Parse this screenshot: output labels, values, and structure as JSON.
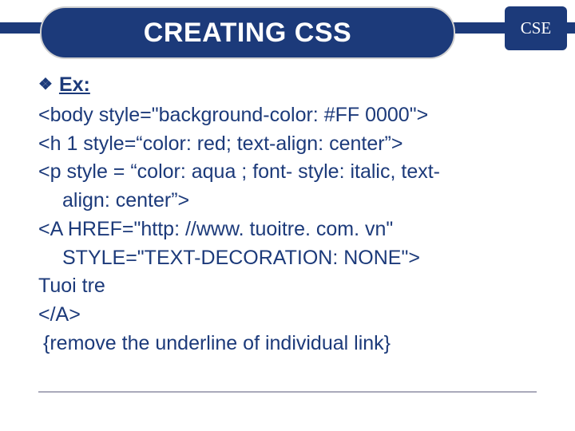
{
  "badge": "CSE",
  "title": "CREATING CSS",
  "bullet_glyph": "❖",
  "ex_label": "Ex:",
  "lines": {
    "l1": "<body style=\"background-color: #FF 0000\">",
    "l2": "<h 1 style=“color: red; text-align: center”>",
    "l3a": "<p style = “color: aqua ; font- style: italic, text-",
    "l3b": "align: center”>",
    "l4a": "<A HREF=\"http: //www. tuoitre. com. vn\"",
    "l4b": "STYLE=\"TEXT-DECORATION: NONE\">",
    "l5": "Tuoi tre",
    "l6": "</A>",
    "l7": "{remove the underline of individual link}"
  }
}
